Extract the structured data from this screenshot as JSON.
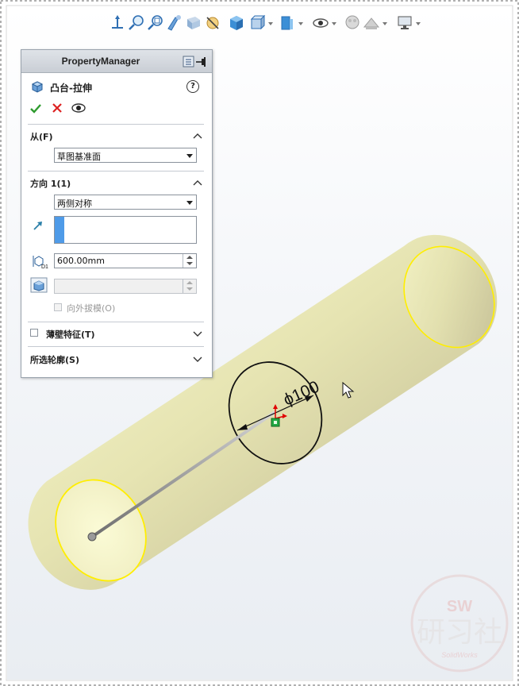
{
  "property_manager": {
    "header_title": "PropertyManager",
    "feature_title": "凸台-拉伸",
    "help_label": "?",
    "from": {
      "label": "从(F)",
      "selected": "草图基准面"
    },
    "direction1": {
      "label": "方向 1(1)",
      "end_condition": "两侧对称",
      "depth_value": "600.00mm",
      "draft_outward_label": "向外拔模(O)",
      "depth_icon_label": "D1"
    },
    "thin_feature": {
      "label": "薄壁特征(T)"
    },
    "selected_contours": {
      "label": "所选轮廓(S)"
    }
  },
  "graphics": {
    "dimension_label": "ϕ100",
    "colors": {
      "part_face": "#e8e6b8",
      "edge_highlight": "#ffee00",
      "sketch_line": "#111111"
    }
  },
  "watermark": {
    "top": "SW",
    "main": "研习社",
    "sub": "SolidWorks"
  }
}
